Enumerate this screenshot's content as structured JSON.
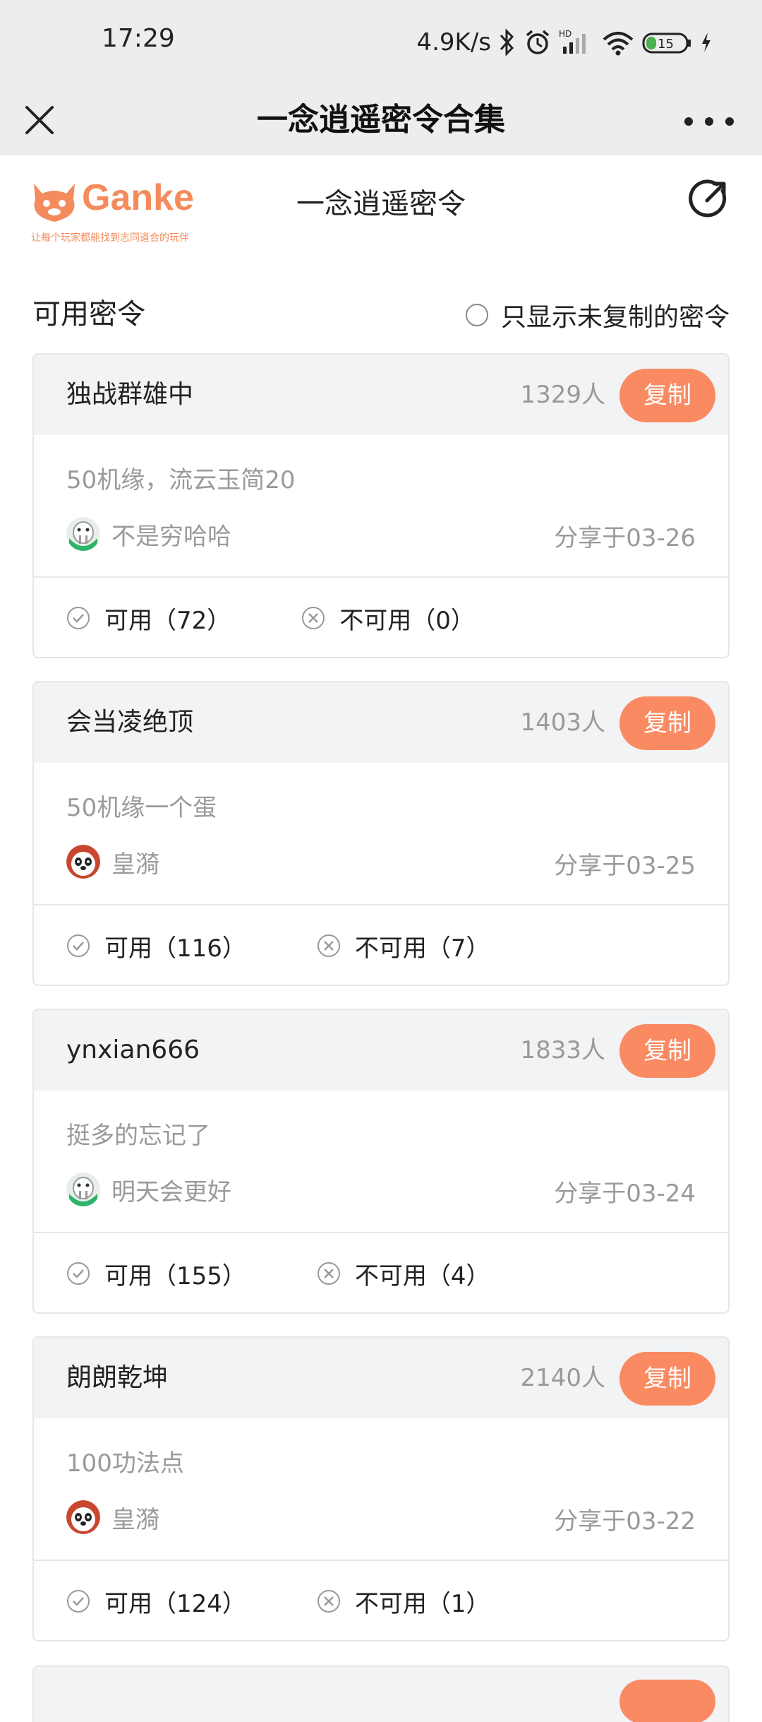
{
  "status_bar": {
    "time": "17:29",
    "net_speed": "4.9K/s",
    "battery": "15"
  },
  "titlebar": {
    "title": "一念逍遥密令合集"
  },
  "header": {
    "logo_text": "Ganke",
    "logo_slogan": "让每个玩家都能找到志同道合的玩伴",
    "page_title": "一念逍遥密令"
  },
  "section": {
    "title": "可用密令",
    "filter_label": "只显示未复制的密令"
  },
  "cards": [
    {
      "code": "独战群雄中",
      "count": "1329人",
      "copy_label": "复制",
      "desc": "50机缘，流云玉简20",
      "user": "不是穷哈哈",
      "avatar_icon": "walrus-avatar",
      "date": "分享于03-26",
      "usable": "可用（72）",
      "unusable": "不可用（0）"
    },
    {
      "code": "会当凌绝顶",
      "count": "1403人",
      "copy_label": "复制",
      "desc": "50机缘一个蛋",
      "user": "皇漪",
      "avatar_icon": "panda-avatar",
      "date": "分享于03-25",
      "usable": "可用（116）",
      "unusable": "不可用（7）"
    },
    {
      "code": "ynxian666",
      "count": "1833人",
      "copy_label": "复制",
      "desc": "挺多的忘记了",
      "user": "明天会更好",
      "avatar_icon": "walrus-avatar",
      "date": "分享于03-24",
      "usable": "可用（155）",
      "unusable": "不可用（4）"
    },
    {
      "code": "朗朗乾坤",
      "count": "2140人",
      "copy_label": "复制",
      "desc": "100功法点",
      "user": "皇漪",
      "avatar_icon": "panda-avatar",
      "date": "分享于03-22",
      "usable": "可用（124）",
      "unusable": "不可用（1）"
    }
  ],
  "colors": {
    "accent": "#f98a62",
    "brand": "#f48b5c",
    "card_header_bg": "#f2f3f5",
    "muted_text": "#9a9a9a"
  }
}
